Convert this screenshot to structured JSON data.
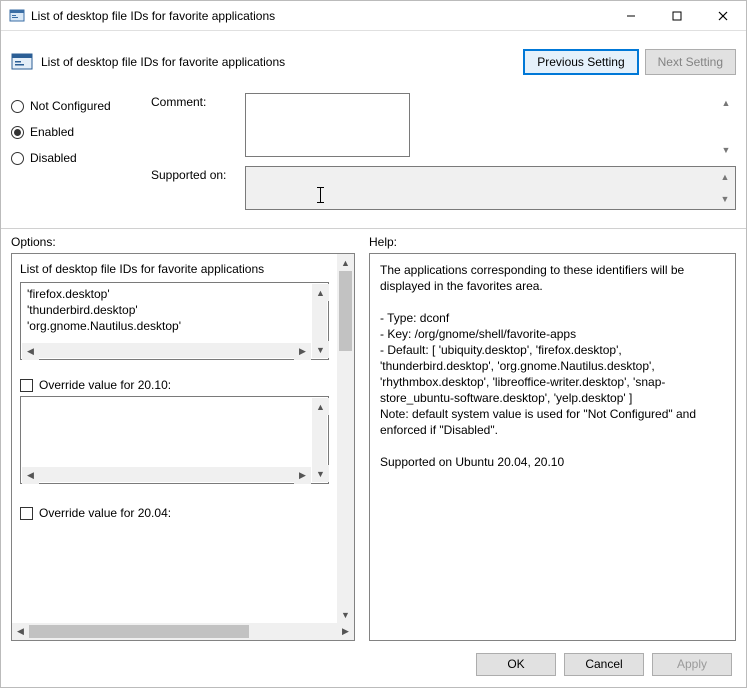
{
  "window": {
    "title": "List of desktop file IDs for favorite applications"
  },
  "header": {
    "title": "List of desktop file IDs for favorite applications",
    "prev_label": "Previous Setting",
    "next_label": "Next Setting"
  },
  "state": {
    "not_configured": "Not Configured",
    "enabled": "Enabled",
    "disabled": "Disabled",
    "selected": "enabled"
  },
  "fields": {
    "comment_label": "Comment:",
    "comment_value": "",
    "supported_label": "Supported on:",
    "supported_value": ""
  },
  "labels": {
    "options": "Options:",
    "help": "Help:"
  },
  "options": {
    "list_title": "List of desktop file IDs for favorite applications",
    "list_items": [
      "'firefox.desktop'",
      "'thunderbird.desktop'",
      "'org.gnome.Nautilus.desktop'"
    ],
    "override1_label": "Override value for 20.10:",
    "override1_checked": false,
    "override2_label": "Override value for 20.04:",
    "override2_checked": false
  },
  "help": {
    "text": "The applications corresponding to these identifiers will be displayed in the favorites area.\n\n- Type: dconf\n- Key: /org/gnome/shell/favorite-apps\n- Default: [ 'ubiquity.desktop', 'firefox.desktop', 'thunderbird.desktop', 'org.gnome.Nautilus.desktop', 'rhythmbox.desktop', 'libreoffice-writer.desktop', 'snap-store_ubuntu-software.desktop', 'yelp.desktop' ]\nNote: default system value is used for \"Not Configured\" and enforced if \"Disabled\".\n\nSupported on Ubuntu 20.04, 20.10"
  },
  "footer": {
    "ok": "OK",
    "cancel": "Cancel",
    "apply": "Apply"
  }
}
